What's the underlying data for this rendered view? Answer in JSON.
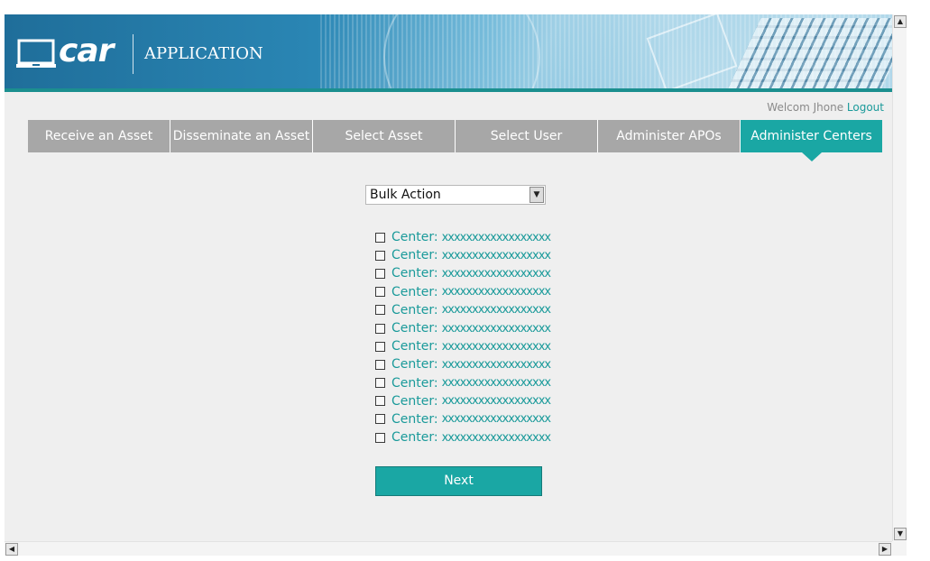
{
  "header": {
    "logo_text": "car",
    "app_title": "APPLICATION"
  },
  "user": {
    "welcome_text": "Welcom Jhone",
    "logout_label": "Logout"
  },
  "nav": {
    "tabs": [
      {
        "label": "Receive an Asset",
        "active": false
      },
      {
        "label": "Disseminate an Asset",
        "active": false
      },
      {
        "label": "Select Asset",
        "active": false
      },
      {
        "label": "Select User",
        "active": false
      },
      {
        "label": "Administer APOs",
        "active": false
      },
      {
        "label": "Administer Centers",
        "active": true
      }
    ]
  },
  "bulk_action": {
    "selected": "Bulk Action"
  },
  "centers": [
    {
      "label": "Center:",
      "value": "xxxxxxxxxxxxxxxxxx",
      "checked": false
    },
    {
      "label": "Center:",
      "value": "xxxxxxxxxxxxxxxxxx",
      "checked": false
    },
    {
      "label": "Center:",
      "value": "xxxxxxxxxxxxxxxxxx",
      "checked": false
    },
    {
      "label": "Center:",
      "value": "xxxxxxxxxxxxxxxxxx",
      "checked": false
    },
    {
      "label": "Center:",
      "value": "xxxxxxxxxxxxxxxxxx",
      "checked": false
    },
    {
      "label": "Center:",
      "value": "xxxxxxxxxxxxxxxxxx",
      "checked": false
    },
    {
      "label": "Center:",
      "value": "xxxxxxxxxxxxxxxxxx",
      "checked": false
    },
    {
      "label": "Center:",
      "value": "xxxxxxxxxxxxxxxxxx",
      "checked": false
    },
    {
      "label": "Center:",
      "value": "xxxxxxxxxxxxxxxxxx",
      "checked": false
    },
    {
      "label": "Center:",
      "value": "xxxxxxxxxxxxxxxxxx",
      "checked": false
    },
    {
      "label": "Center:",
      "value": "xxxxxxxxxxxxxxxxxx",
      "checked": false
    },
    {
      "label": "Center:",
      "value": "xxxxxxxxxxxxxxxxxx",
      "checked": false
    }
  ],
  "next_label": "Next",
  "colors": {
    "accent": "#1aa7a4",
    "tab_inactive": "#a7a7a7",
    "header_blue": "#2a86b4",
    "page_bg": "#efefef"
  },
  "icons": {
    "logo": "laptop-icon",
    "select_arrow": "chevron-down-icon",
    "scroll_up": "arrow-up-icon",
    "scroll_down": "arrow-down-icon",
    "scroll_left": "arrow-left-icon",
    "scroll_right": "arrow-right-icon"
  }
}
